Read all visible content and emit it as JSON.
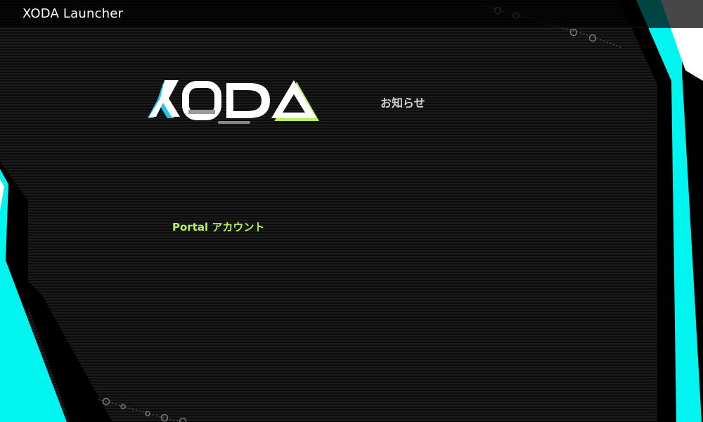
{
  "window": {
    "title": "XODA Launcher"
  },
  "logo": {
    "text": "XODA"
  },
  "news": {
    "heading": "お知らせ"
  },
  "account": {
    "portal_link": "Portal アカウント"
  },
  "colors": {
    "accent_cyan": "#00f5f0",
    "accent_lime": "#b8f060",
    "background": "#0b0b0b"
  }
}
